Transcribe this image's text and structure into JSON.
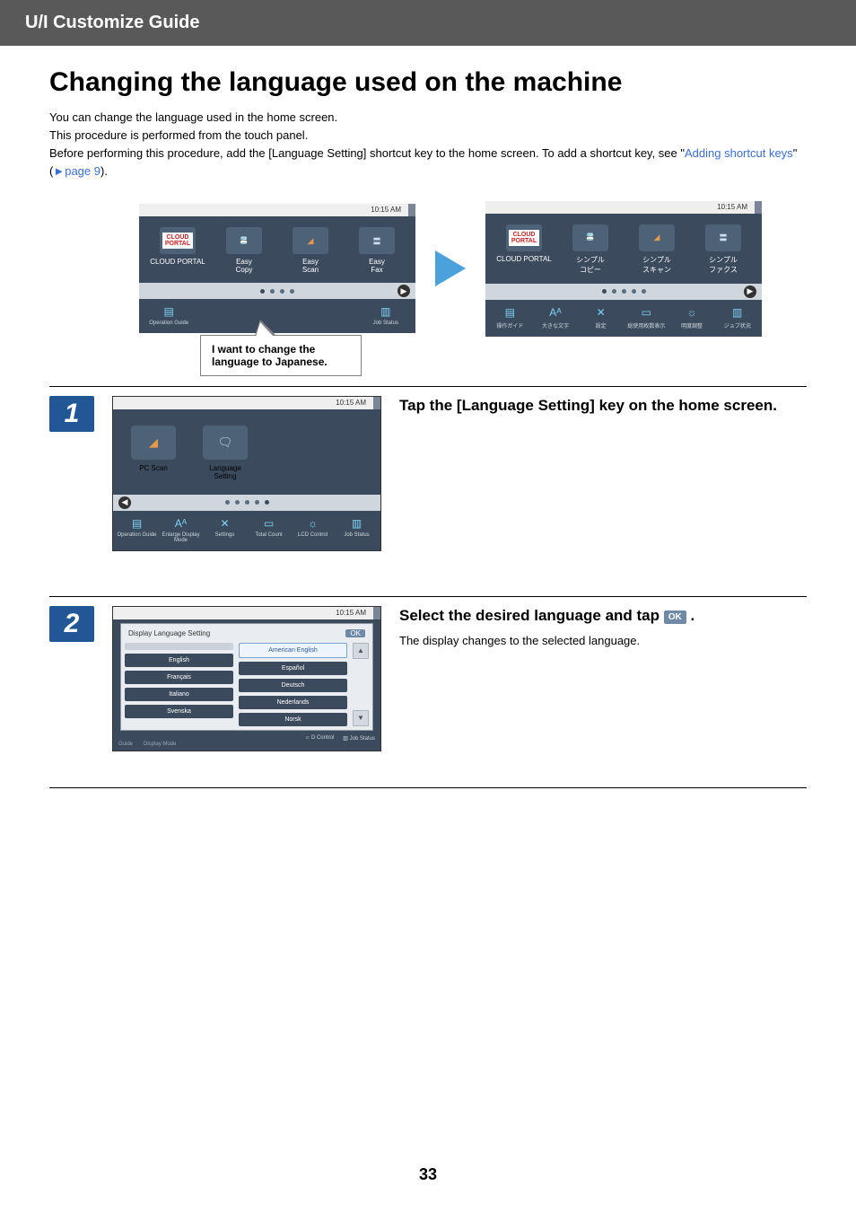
{
  "header": {
    "title": "U/I Customize Guide"
  },
  "page": {
    "h1": "Changing the language used on the machine",
    "intro1": "You can change the language used in the home screen.",
    "intro2": "This procedure is performed from the touch panel.",
    "intro3_pre": "Before performing this procedure, add the [Language Setting] shortcut key to the home screen. To add a shortcut key, see \"",
    "intro3_link": "Adding shortcut keys",
    "intro3_mid": "\" (",
    "intro3_pglink": "►page 9",
    "intro3_post": ")."
  },
  "before": {
    "time": "10:15 AM",
    "tiles": [
      {
        "label": "CLOUD PORTAL",
        "icon": "cloud"
      },
      {
        "label": "Easy\nCopy",
        "icon": "copy"
      },
      {
        "label": "Easy\nScan",
        "icon": "scan"
      },
      {
        "label": "Easy\nFax",
        "icon": "fax"
      }
    ],
    "bottom": [
      {
        "label": "Operation\nGuide"
      },
      {
        "label": ""
      },
      {
        "label": ""
      },
      {
        "label": ""
      },
      {
        "label": ""
      },
      {
        "label": "Job Status"
      }
    ],
    "speech": "I want to change the language to Japanese."
  },
  "after": {
    "time": "10:15 AM",
    "tiles": [
      {
        "label": "CLOUD PORTAL"
      },
      {
        "label": "シンプル\nコピー"
      },
      {
        "label": "シンプル\nスキャン"
      },
      {
        "label": "シンプル\nファクス"
      }
    ],
    "bottom": [
      {
        "label": "操作ガイド"
      },
      {
        "label": "大きな文字"
      },
      {
        "label": "設定"
      },
      {
        "label": "総使用枚数表示"
      },
      {
        "label": "明度調整"
      },
      {
        "label": "ジョブ状況"
      }
    ]
  },
  "step1": {
    "num": "1",
    "title": "Tap the [Language Setting] key on the home screen.",
    "time": "10:15 AM",
    "tiles": [
      {
        "label": "PC Scan"
      },
      {
        "label": "Language\nSetting"
      }
    ],
    "bottom": [
      {
        "label": "Operation\nGuide"
      },
      {
        "label": "Enlarge\nDisplay Mode"
      },
      {
        "label": "Settings"
      },
      {
        "label": "Total Count"
      },
      {
        "label": "LCD Control"
      },
      {
        "label": "Job Status"
      }
    ]
  },
  "step2": {
    "num": "2",
    "title_pre": "Select the desired language and tap ",
    "title_post": " .",
    "ok_chip": "OK",
    "body": "The display changes to the selected language.",
    "time": "10:15 AM",
    "dialog_title": "Display Language Setting",
    "ok": "OK",
    "langs_left": [
      "",
      "English",
      "Français",
      "Italiano",
      "Svenska"
    ],
    "langs_right": [
      "American English",
      "Español",
      "Deutsch",
      "Nederlands",
      "Norsk"
    ],
    "bbar": [
      "Guide",
      "Display Mode"
    ],
    "rbar": [
      "D Control",
      "Job Status"
    ]
  },
  "pagenum": "33"
}
